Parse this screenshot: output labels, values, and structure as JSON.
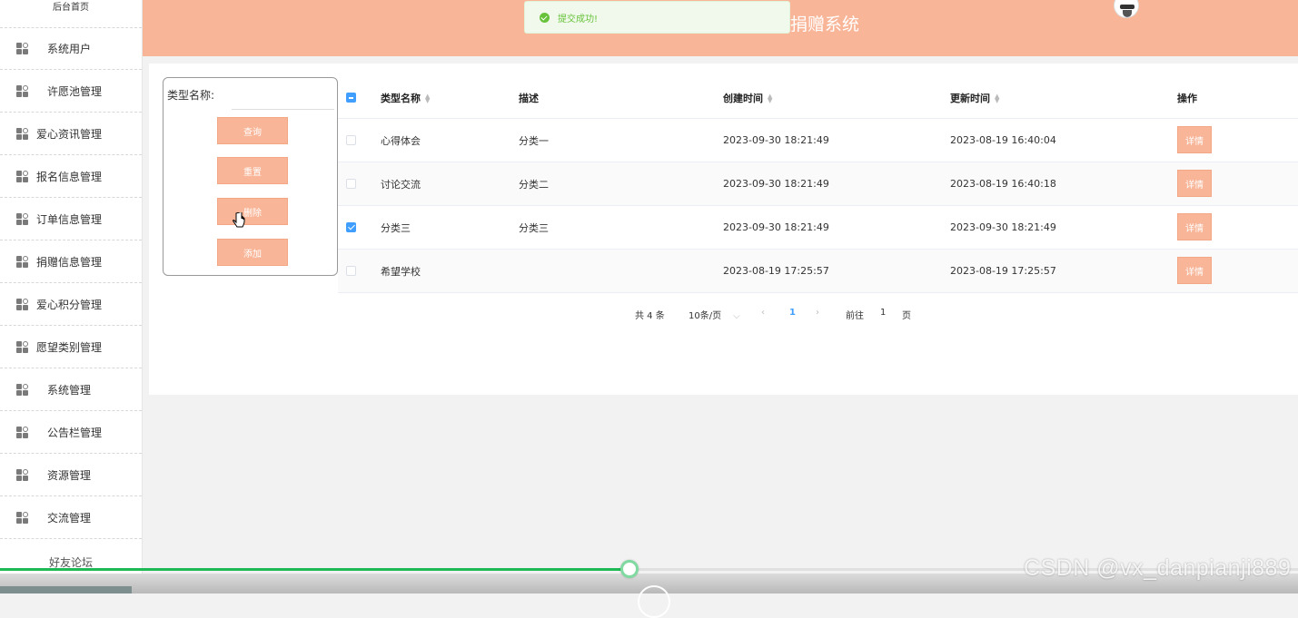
{
  "sidebar": {
    "top_label": "后台首页",
    "items": [
      {
        "label": "系统用户",
        "pad": true
      },
      {
        "label": "许愿池管理",
        "pad": true
      },
      {
        "label": "爱心资讯管理",
        "pad": false
      },
      {
        "label": "报名信息管理",
        "pad": false
      },
      {
        "label": "订单信息管理",
        "pad": false
      },
      {
        "label": "捐赠信息管理",
        "pad": false
      },
      {
        "label": "爱心积分管理",
        "pad": false
      },
      {
        "label": "愿望类别管理",
        "pad": false
      },
      {
        "label": "系统管理",
        "pad": true
      },
      {
        "label": "公告栏管理",
        "pad": true
      },
      {
        "label": "资源管理",
        "pad": true
      },
      {
        "label": "交流管理",
        "pad": true
      }
    ],
    "last_label": "好友论坛"
  },
  "header": {
    "title": "捐赠系统"
  },
  "toast": {
    "message": "提交成功!"
  },
  "search": {
    "label": "类型名称:",
    "value": "",
    "buttons": {
      "query": "查询",
      "reset": "重置",
      "delete": "删除",
      "add": "添加"
    }
  },
  "table": {
    "columns": [
      "类型名称",
      "描述",
      "创建时间",
      "更新时间",
      "操作"
    ],
    "rows": [
      {
        "name": "心得体会",
        "desc": "分类一",
        "created": "2023-09-30 18:21:49",
        "updated": "2023-08-19 16:40:04",
        "checked": false
      },
      {
        "name": "讨论交流",
        "desc": "分类二",
        "created": "2023-09-30 18:21:49",
        "updated": "2023-08-19 16:40:18",
        "checked": false
      },
      {
        "name": "分类三",
        "desc": "分类三",
        "created": "2023-09-30 18:21:49",
        "updated": "2023-09-30 18:21:49",
        "checked": true
      },
      {
        "name": "希望学校",
        "desc": "",
        "created": "2023-08-19 17:25:57",
        "updated": "2023-08-19 17:25:57",
        "checked": false
      }
    ],
    "detail_label": "详情"
  },
  "pagination": {
    "total": "共 4 条",
    "page_size": "10条/页",
    "current_page": "1",
    "goto_prefix": "前往",
    "goto_value": "1",
    "goto_suffix": "页"
  },
  "video": {
    "progress": 0.485
  },
  "watermark": "CSDN @vx_danpianji889",
  "colors": {
    "header": "#f9b597",
    "button": "#f9b597",
    "checkbox": "#409eff",
    "toast_text": "#67c23a",
    "progress": "#1db954"
  }
}
